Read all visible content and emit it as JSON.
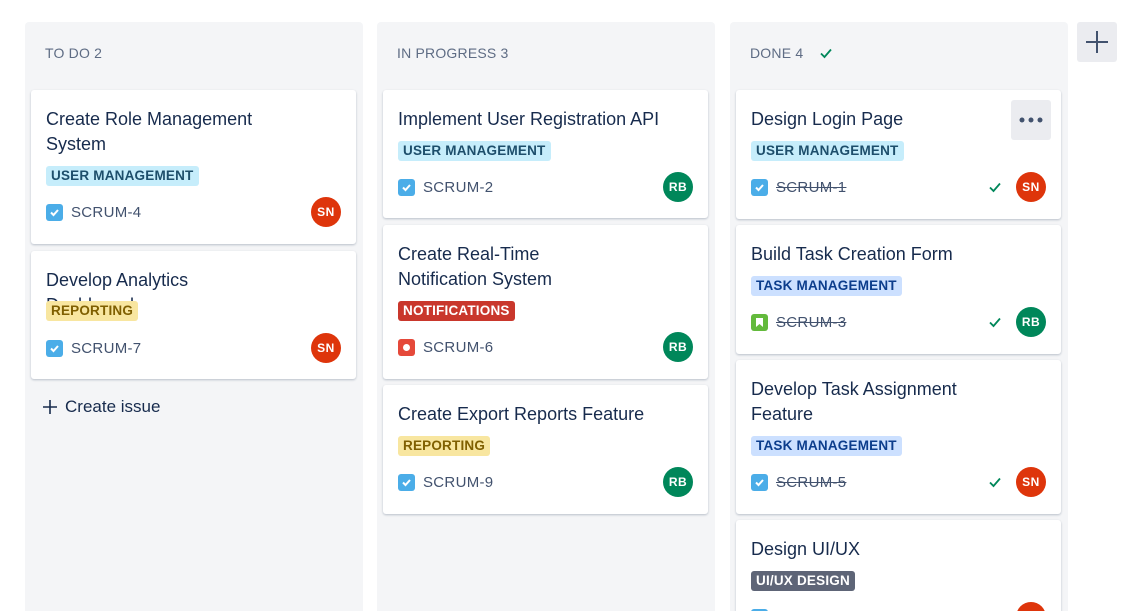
{
  "columns": [
    {
      "title": "TO DO 2",
      "cards": [
        {
          "title": "Create Role Management System",
          "label": "USER MANAGEMENT",
          "key": "SCRUM-4",
          "assignee": "SN"
        },
        {
          "title": "Develop Analytics Dashboard",
          "label": "REPORTING",
          "key": "SCRUM-7",
          "assignee": "SN"
        }
      ],
      "create_issue": "Create issue"
    },
    {
      "title": "IN PROGRESS 3",
      "cards": [
        {
          "title": "Implement User Registration API",
          "label": "USER MANAGEMENT",
          "key": "SCRUM-2",
          "assignee": "RB"
        },
        {
          "title": "Create Real-Time Notification System",
          "label": "NOTIFICATIONS",
          "key": "SCRUM-6",
          "assignee": "RB"
        },
        {
          "title": "Create Export Reports Feature",
          "label": "REPORTING",
          "key": "SCRUM-9",
          "assignee": "RB"
        }
      ]
    },
    {
      "title": "DONE 4",
      "cards": [
        {
          "title": "Design Login Page",
          "label": "USER MANAGEMENT",
          "key": "SCRUM-1",
          "assignee": "SN"
        },
        {
          "title": "Build Task Creation Form",
          "label": "TASK MANAGEMENT",
          "key": "SCRUM-3",
          "assignee": "RB"
        },
        {
          "title": "Develop Task Assignment Feature",
          "label": "TASK MANAGEMENT",
          "key": "SCRUM-5",
          "assignee": "SN"
        },
        {
          "title": "Design UI/UX",
          "label": "UI/UX DESIGN",
          "key": "",
          "assignee": ""
        }
      ]
    }
  ],
  "colors": {
    "column_bg": "#f4f5f7",
    "avatar_sn": "#de350b",
    "avatar_rb": "#00875a",
    "done_check": "#00875a"
  }
}
